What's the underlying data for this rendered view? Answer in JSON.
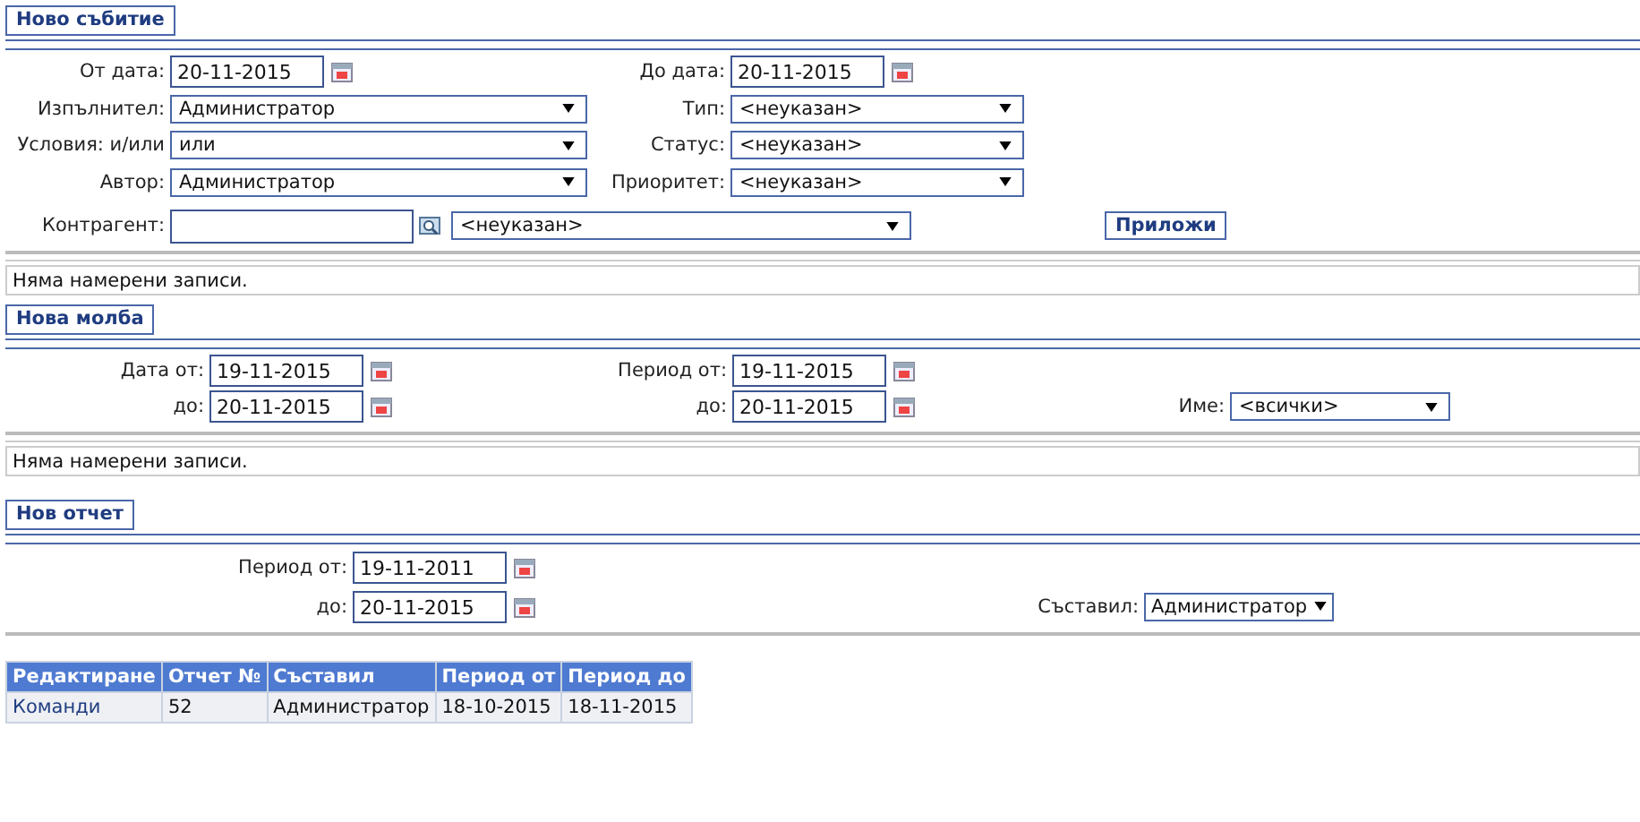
{
  "event": {
    "title": "Ново събитие",
    "rows": [
      {
        "left": {
          "label": "От дата:",
          "kind": "date",
          "value": "20-11-2015"
        },
        "right": {
          "label": "До дата:",
          "kind": "date",
          "value": "20-11-2015"
        }
      },
      {
        "left": {
          "label": "Изпълнител:",
          "kind": "select",
          "value": "Администратор"
        },
        "right": {
          "label": "Тип:",
          "kind": "select",
          "value": "<неуказан>"
        }
      },
      {
        "left": {
          "label": "Условия: и/или",
          "kind": "select",
          "value": "или"
        },
        "right": {
          "label": "Статус:",
          "kind": "select",
          "value": "<неуказан>"
        }
      },
      {
        "left": {
          "label": "Автор:",
          "kind": "select",
          "value": "Администратор"
        },
        "right": {
          "label": "Приоритет:",
          "kind": "select",
          "value": "<неуказан>"
        }
      }
    ],
    "contractor": {
      "label": "Контрагент:",
      "select": "<неуказан>"
    },
    "apply_button": "Приложи",
    "message": "Няма намерени записи."
  },
  "request": {
    "title": "Нова молба",
    "date_from": {
      "label": "Дата от:",
      "value": "19-11-2015"
    },
    "date_to": {
      "label": "до:",
      "value": "20-11-2015"
    },
    "period_from": {
      "label": "Период от:",
      "value": "19-11-2015"
    },
    "period_to": {
      "label": "до:",
      "value": "20-11-2015"
    },
    "name": {
      "label": "Име:",
      "value": "<всички>"
    },
    "message": "Няма намерени записи."
  },
  "report": {
    "title": "Нов отчет",
    "period_from": {
      "label": "Период от:",
      "value": "19-11-2011"
    },
    "period_to": {
      "label": "до:",
      "value": "20-11-2015"
    },
    "author": {
      "label": "Съставил:",
      "value": "Администратор"
    },
    "table": {
      "columns": [
        "Редактиране",
        "Отчет №",
        "Съставил",
        "Период от",
        "Период до"
      ],
      "rows": [
        [
          "Команди",
          "52",
          "Администратор",
          "18-10-2015",
          "18-11-2015"
        ]
      ]
    }
  }
}
